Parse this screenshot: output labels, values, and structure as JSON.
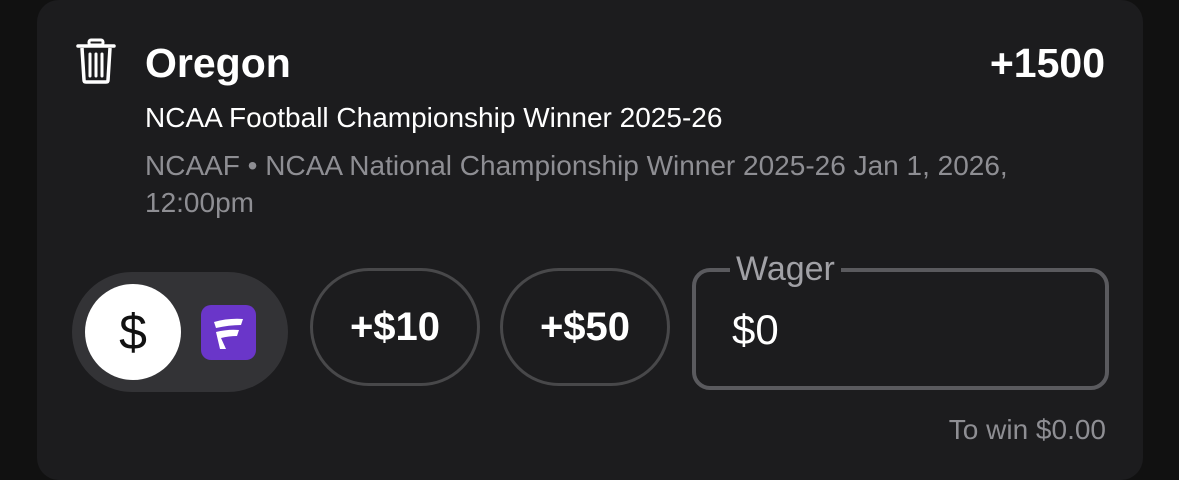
{
  "bet": {
    "team": "Oregon",
    "odds": "+1500",
    "market": "NCAA Football Championship Winner 2025-26",
    "details": "NCAAF • NCAA National Championship Winner 2025-26 Jan 1, 2026, 12:00pm"
  },
  "controls": {
    "dollar_symbol": "$",
    "quick_add_10": "+$10",
    "quick_add_50": "+$50"
  },
  "wager": {
    "label": "Wager",
    "value": "$0"
  },
  "to_win": "To win $0.00",
  "colors": {
    "card_bg": "#1c1c1e",
    "page_bg": "#111111",
    "fanduel_purple": "#6a36c9",
    "muted_text": "#8e8e93"
  },
  "icons": {
    "delete": "trash-icon",
    "currency": "dollar-icon",
    "bonus_token": "fanduel-logo-icon"
  }
}
